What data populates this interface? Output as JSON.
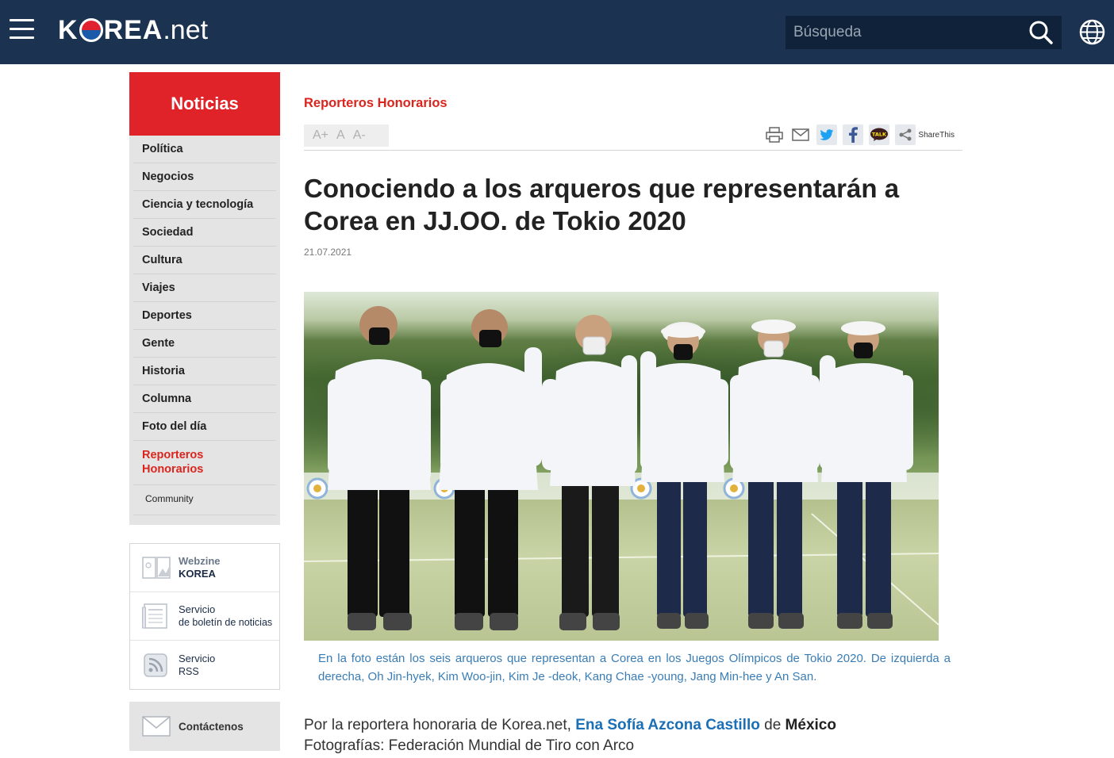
{
  "header": {
    "logo_prefix": "K",
    "logo_suffix": "REA",
    "logo_net": ".net",
    "search_placeholder": "Búsqueda"
  },
  "sidebar": {
    "title": "Noticias",
    "items": [
      {
        "label": "Política"
      },
      {
        "label": "Negocios"
      },
      {
        "label": "Ciencia y tecnología"
      },
      {
        "label": "Sociedad"
      },
      {
        "label": "Cultura"
      },
      {
        "label": "Viajes"
      },
      {
        "label": "Deportes"
      },
      {
        "label": "Gente"
      },
      {
        "label": "Historia"
      },
      {
        "label": "Columna"
      },
      {
        "label": "Foto del día"
      },
      {
        "label": "Reporteros Honorarios",
        "active": true
      },
      {
        "label": "Community"
      }
    ],
    "boxes": [
      {
        "line1": "Webzine",
        "line2": "KOREA"
      },
      {
        "line1": "Servicio",
        "line2": "de boletín de noticias"
      },
      {
        "line1": "Servicio",
        "line2": "RSS"
      }
    ],
    "contact": "Contáctenos"
  },
  "article": {
    "category": "Reporteros Honorarios",
    "font_controls": [
      "A+",
      "A",
      "A-"
    ],
    "share_label": "ShareThis",
    "title": "Conociendo a los arqueros que representarán a Corea en JJ.OO. de Tokio 2020",
    "date": "21.07.2021",
    "caption": "En la foto están los seis arqueros que representan a Corea en los Juegos Olímpicos de Tokio 2020. De izquierda a derecha, Oh Jin-hyek, Kim Woo-jin, Kim Je -deok, Kang Chae -young, Jang Min-hee y An San.",
    "byline_prefix": "Por la reportera honoraria de Korea.net,",
    "byline_author": "Ena Sofía Azcona Castillo",
    "byline_de": "de",
    "byline_country": "México",
    "photo_credit": "Fotografías: Federación Mundial de Tiro con Arco"
  },
  "colors": {
    "header_bg": "#1b3250",
    "accent_red": "#e02229",
    "link_blue": "#1a6fb5",
    "caption_blue": "#3a7db5"
  }
}
